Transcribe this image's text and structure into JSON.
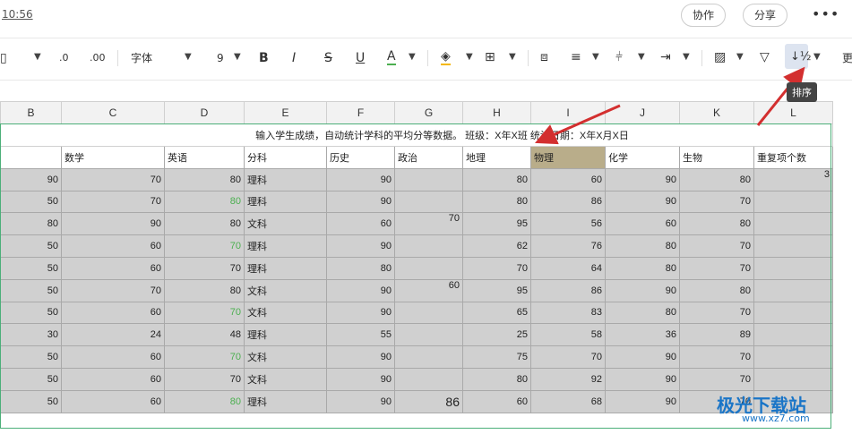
{
  "topbar": {
    "time": "10:56",
    "collab_label": "协作",
    "share_label": "分享",
    "more_label": "•••"
  },
  "toolbar": {
    "decimal_dec": ".0",
    "decimal_inc": ".00",
    "font_name": "字体",
    "font_size": "9",
    "bold": "B",
    "italic": "I",
    "strike": "S",
    "underline": "U",
    "font_color": "A",
    "more": "更",
    "sort_tooltip": "排序"
  },
  "columns": [
    "B",
    "C",
    "D",
    "E",
    "F",
    "G",
    "H",
    "I",
    "J",
    "K",
    "L"
  ],
  "sheet": {
    "title_row": "输入学生成绩，自动统计学科的平均分等数据。 班级：X年X班 统计日期：X年X月X日",
    "headers": [
      "",
      "数学",
      "英语",
      "分科",
      "历史",
      "政治",
      "地理",
      "物理",
      "化学",
      "生物",
      "重复项个数"
    ],
    "rows": [
      [
        "90",
        "70",
        "80",
        "理科",
        "90",
        "",
        "80",
        "60",
        "90",
        "80",
        "3"
      ],
      [
        "50",
        "70",
        "80",
        "理科",
        "90",
        "",
        "80",
        "86",
        "90",
        "70",
        ""
      ],
      [
        "80",
        "90",
        "80",
        "文科",
        "60",
        "70",
        "95",
        "56",
        "60",
        "80",
        ""
      ],
      [
        "50",
        "60",
        "70",
        "理科",
        "90",
        "",
        "62",
        "76",
        "80",
        "70",
        ""
      ],
      [
        "50",
        "60",
        "70",
        "理科",
        "80",
        "",
        "70",
        "64",
        "80",
        "70",
        ""
      ],
      [
        "50",
        "70",
        "80",
        "文科",
        "90",
        "60",
        "95",
        "86",
        "90",
        "80",
        ""
      ],
      [
        "50",
        "60",
        "70",
        "文科",
        "90",
        "",
        "65",
        "83",
        "80",
        "70",
        ""
      ],
      [
        "30",
        "24",
        "48",
        "理科",
        "55",
        "",
        "25",
        "58",
        "36",
        "89",
        ""
      ],
      [
        "50",
        "60",
        "70",
        "文科",
        "90",
        "",
        "75",
        "70",
        "90",
        "70",
        ""
      ],
      [
        "50",
        "60",
        "70",
        "文科",
        "90",
        "",
        "80",
        "92",
        "90",
        "70",
        ""
      ],
      [
        "50",
        "60",
        "80",
        "理科",
        "90",
        "86",
        "60",
        "68",
        "90",
        "70",
        ""
      ]
    ],
    "green_cells": [
      [
        1,
        2
      ],
      [
        3,
        2
      ],
      [
        6,
        2
      ],
      [
        8,
        2
      ],
      [
        10,
        2
      ]
    ]
  },
  "watermark": {
    "line1": "极光下载站",
    "line2": "www.xz7.com"
  },
  "colors": {
    "arrow": "#d32f2f",
    "selection": "#4caf79",
    "physics_header": "#b9ad8a"
  }
}
